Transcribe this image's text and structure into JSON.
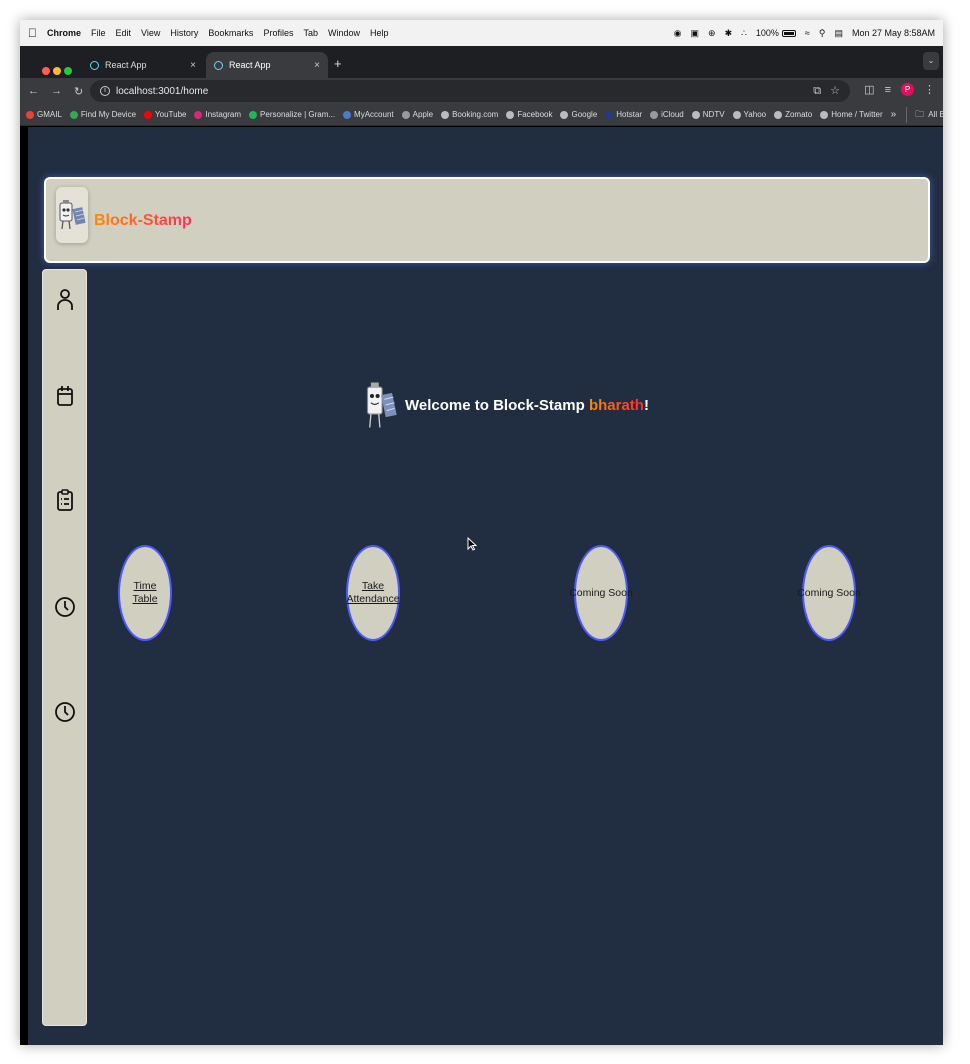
{
  "menubar": {
    "app": "Chrome",
    "items": [
      "File",
      "Edit",
      "View",
      "History",
      "Bookmarks",
      "Profiles",
      "Tab",
      "Window",
      "Help"
    ],
    "battery": "100%",
    "datetime": "Mon 27 May  8:58AM"
  },
  "tabs": [
    {
      "title": "React App",
      "close": "×"
    },
    {
      "title": "React App",
      "close": "×"
    }
  ],
  "new_tab": "+",
  "address": {
    "url": "localhost:3001/home"
  },
  "profile_initial": "P",
  "bookmarks": {
    "items": [
      "GMAIL",
      "Find My Device",
      "YouTube",
      "Instagram",
      "Personalize | Gram...",
      "MyAccount",
      "Apple",
      "Booking.com",
      "Facebook",
      "Google",
      "Hotstar",
      "iCloud",
      "NDTV",
      "Yahoo",
      "Zomato",
      "Home / Twitter"
    ],
    "more": "»",
    "all": "All Bookmarks"
  },
  "header": {
    "brand": "Block-Stamp"
  },
  "sidebar": {
    "icons": [
      "user-icon",
      "calendar-icon",
      "clipboard-icon",
      "clock-icon",
      "clock-icon"
    ]
  },
  "welcome": {
    "prefix": "Welcome to Block-Stamp ",
    "user": "bharath",
    "suffix": "!"
  },
  "cards": {
    "timetable": "Time Table",
    "take": "Take",
    "attendance": "Attendance",
    "soon1": "Coming Soon",
    "soon2": "Coming Soon"
  },
  "colors": {
    "page_bg": "#212d41",
    "panel": "#d1cfc0",
    "circle_border": "#4b59ff",
    "brand_gradient_start": "#ff8a00",
    "brand_gradient_end": "#ff2a5f"
  }
}
